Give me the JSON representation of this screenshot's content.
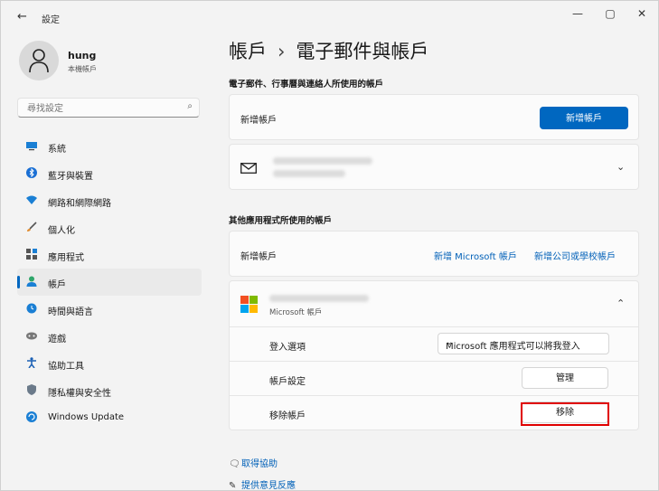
{
  "window": {
    "title": "設定",
    "controls": {
      "minimize": "—",
      "maximize": "▢",
      "close": "✕"
    }
  },
  "user": {
    "name": "hung",
    "subtitle": "本機帳戶"
  },
  "search": {
    "placeholder": "尋找設定"
  },
  "sidebar": {
    "items": [
      {
        "label": "系統",
        "icon": "monitor-icon",
        "active": false
      },
      {
        "label": "藍牙與裝置",
        "icon": "bluetooth-icon",
        "active": false
      },
      {
        "label": "網路和網際網路",
        "icon": "wifi-icon",
        "active": false
      },
      {
        "label": "個人化",
        "icon": "brush-icon",
        "active": false
      },
      {
        "label": "應用程式",
        "icon": "apps-icon",
        "active": false
      },
      {
        "label": "帳戶",
        "icon": "person-icon",
        "active": true
      },
      {
        "label": "時間與語言",
        "icon": "globe-clock-icon",
        "active": false
      },
      {
        "label": "遊戲",
        "icon": "gamepad-icon",
        "active": false
      },
      {
        "label": "協助工具",
        "icon": "accessibility-icon",
        "active": false
      },
      {
        "label": "隱私權與安全性",
        "icon": "shield-icon",
        "active": false
      },
      {
        "label": "Windows Update",
        "icon": "update-icon",
        "active": false
      }
    ]
  },
  "breadcrumb": {
    "parent": "帳戶",
    "separator": "›",
    "current": "電子郵件與帳戶"
  },
  "email_section": {
    "title": "電子郵件、行事曆與連絡人所使用的帳戶",
    "add_label": "新增帳戶",
    "add_button": "新增帳戶"
  },
  "other_section": {
    "title": "其他應用程式所使用的帳戶",
    "add_label": "新增帳戶",
    "add_ms_link": "新增 Microsoft 帳戶",
    "add_work_link": "新增公司或學校帳戶",
    "account_type": "Microsoft 帳戶",
    "signin_label": "登入選項",
    "signin_value": "Microsoft 應用程式可以將我登入",
    "settings_label": "帳戶設定",
    "manage_button": "管理",
    "remove_label": "移除帳戶",
    "remove_button": "移除"
  },
  "help": {
    "get_help": "取得協助",
    "feedback": "提供意見反應"
  },
  "colors": {
    "accent": "#0067c0",
    "highlight": "#e00000"
  }
}
